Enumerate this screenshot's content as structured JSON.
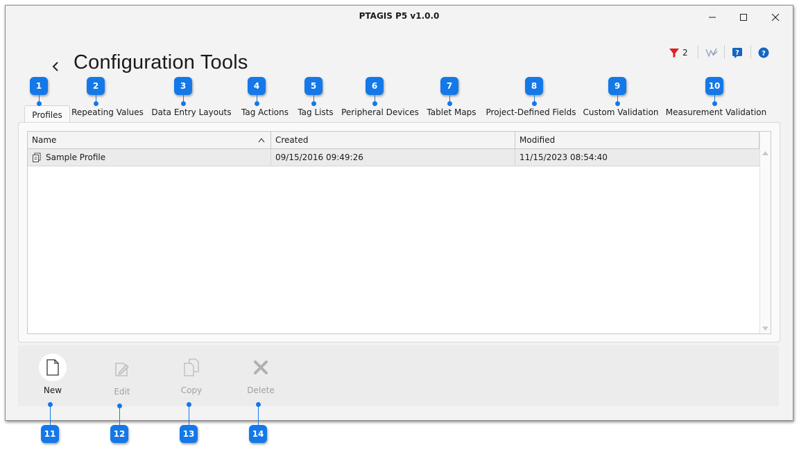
{
  "window": {
    "title": "PTAGIS P5 v1.0.0"
  },
  "toolbar": {
    "filter_count": "2",
    "icons": [
      "filter-icon",
      "signature-icon",
      "help-book-icon",
      "help-circle-icon"
    ]
  },
  "page": {
    "title": "Configuration Tools"
  },
  "tabs": [
    {
      "label": "Profiles",
      "active": true
    },
    {
      "label": "Repeating Values"
    },
    {
      "label": "Data Entry Layouts"
    },
    {
      "label": "Tag Actions"
    },
    {
      "label": "Tag Lists"
    },
    {
      "label": "Peripheral Devices"
    },
    {
      "label": "Tablet Maps"
    },
    {
      "label": "Project-Defined Fields"
    },
    {
      "label": "Custom Validation"
    },
    {
      "label": "Measurement Validation"
    }
  ],
  "grid": {
    "columns": [
      "Name",
      "Created",
      "Modified"
    ],
    "rows": [
      {
        "name": "Sample Profile",
        "created": "09/15/2016 09:49:26",
        "modified": "11/15/2023 08:54:40"
      }
    ]
  },
  "actions": [
    {
      "label": "New",
      "enabled": true
    },
    {
      "label": "Edit",
      "enabled": false
    },
    {
      "label": "Copy",
      "enabled": false
    },
    {
      "label": "Delete",
      "enabled": false
    }
  ],
  "callouts": [
    "1",
    "2",
    "3",
    "4",
    "5",
    "6",
    "7",
    "8",
    "9",
    "10",
    "11",
    "12",
    "13",
    "14"
  ],
  "colors": {
    "callout": "#1478e8",
    "filter_red": "#e02020",
    "help_blue": "#1565c0"
  }
}
